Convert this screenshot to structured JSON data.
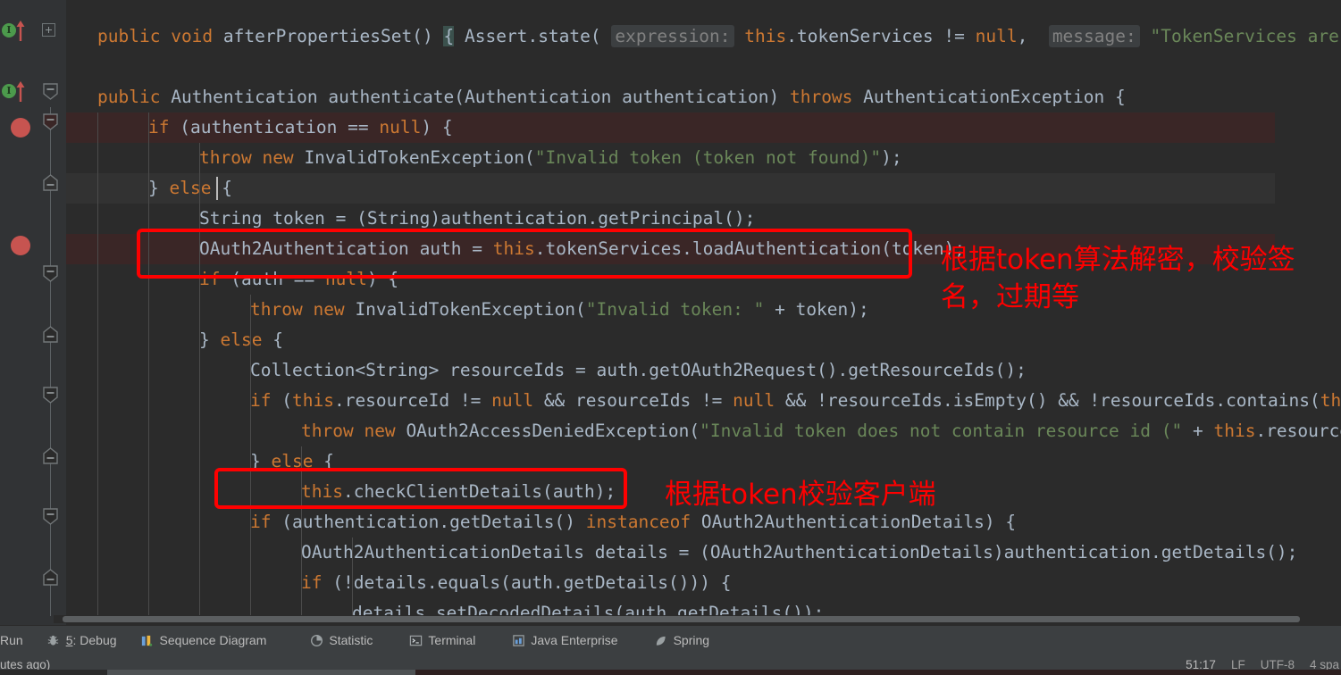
{
  "editor": {
    "language": "java",
    "font_size_px": 19.5,
    "theme": "darcula",
    "background": "#2b2b2b",
    "gutter_background": "#313335",
    "breakpoint_line_background": "#3a2626",
    "caret_line_background": "#323232",
    "lines": [
      {
        "id": "l1",
        "text": "public void afterPropertiesSet() { Assert.state( expression: this.tokenServices != null,  message: \"TokenServices are required\")",
        "indent": 1,
        "gutter": "implementation-and-override",
        "fold": "plus",
        "highlight": "none"
      },
      {
        "id": "l2",
        "text": "public Authentication authenticate(Authentication authentication) throws AuthenticationException {",
        "indent": 1,
        "gutter": "implementation-and-override",
        "fold": "fold-down",
        "highlight": "none"
      },
      {
        "id": "l3",
        "text": "if (authentication == null) {",
        "indent": 2,
        "gutter": "breakpoint",
        "fold": "fold-down",
        "highlight": "breakpoint"
      },
      {
        "id": "l4",
        "text": "throw new InvalidTokenException(\"Invalid token (token not found)\");",
        "indent": 3,
        "gutter": "none",
        "fold": "none",
        "highlight": "none"
      },
      {
        "id": "l5",
        "text": "} else {",
        "indent": 2,
        "gutter": "none",
        "fold": "fold-up",
        "highlight": "caret"
      },
      {
        "id": "l6",
        "text": "String token = (String)authentication.getPrincipal();",
        "indent": 3,
        "gutter": "none",
        "fold": "none",
        "highlight": "none"
      },
      {
        "id": "l7",
        "text": "OAuth2Authentication auth = this.tokenServices.loadAuthentication(token);",
        "indent": 3,
        "gutter": "breakpoint",
        "fold": "none",
        "highlight": "breakpoint"
      },
      {
        "id": "l8",
        "text": "if (auth == null) {",
        "indent": 3,
        "gutter": "none",
        "fold": "fold-down",
        "highlight": "none"
      },
      {
        "id": "l9",
        "text": "throw new InvalidTokenException(\"Invalid token: \" + token);",
        "indent": 4,
        "gutter": "none",
        "fold": "none",
        "highlight": "none"
      },
      {
        "id": "l10",
        "text": "} else {",
        "indent": 3,
        "gutter": "none",
        "fold": "fold-up",
        "highlight": "none"
      },
      {
        "id": "l11",
        "text": "Collection<String> resourceIds = auth.getOAuth2Request().getResourceIds();",
        "indent": 4,
        "gutter": "none",
        "fold": "none",
        "highlight": "none"
      },
      {
        "id": "l12",
        "text": "if (this.resourceId != null && resourceIds != null && !resourceIds.isEmpty() && !resourceIds.contains(this.resourc",
        "indent": 4,
        "gutter": "none",
        "fold": "fold-down",
        "highlight": "none"
      },
      {
        "id": "l13",
        "text": "throw new OAuth2AccessDeniedException(\"Invalid token does not contain resource id (\" + this.resourceId + \")\");",
        "indent": 5,
        "gutter": "none",
        "fold": "none",
        "highlight": "none"
      },
      {
        "id": "l14",
        "text": "} else {",
        "indent": 4,
        "gutter": "none",
        "fold": "fold-up",
        "highlight": "none"
      },
      {
        "id": "l15",
        "text": "this.checkClientDetails(auth);",
        "indent": 5,
        "gutter": "none",
        "fold": "none",
        "highlight": "none"
      },
      {
        "id": "l16",
        "text": "if (authentication.getDetails() instanceof OAuth2AuthenticationDetails) {",
        "indent": 5,
        "gutter": "none",
        "fold": "fold-down",
        "highlight": "none"
      },
      {
        "id": "l17",
        "text": "OAuth2AuthenticationDetails details = (OAuth2AuthenticationDetails)authentication.getDetails();",
        "indent": 6,
        "gutter": "none",
        "fold": "none",
        "highlight": "none"
      },
      {
        "id": "l18",
        "text": "if (!details.equals(auth.getDetails())) {",
        "indent": 6,
        "gutter": "none",
        "fold": "fold-down",
        "highlight": "none"
      },
      {
        "id": "l19",
        "text": "details.setDecodedDetails(auth.getDetails());",
        "indent": 7,
        "gutter": "none",
        "fold": "none",
        "highlight": "none"
      }
    ]
  },
  "annotations": {
    "color": "#ff0000",
    "box1_label": "",
    "text1": "根据token算法解密，校验签\n名，过期等",
    "box2_label": "",
    "text2": "根据token校验客户端"
  },
  "toolbar": {
    "items": [
      {
        "label": "Run",
        "icon": "run-icon",
        "shortcut": ""
      },
      {
        "label": "Debug",
        "icon": "bug-icon",
        "shortcut": "5"
      },
      {
        "label": "Sequence Diagram",
        "icon": "sequence-diagram-icon",
        "shortcut": ""
      },
      {
        "label": "Statistic",
        "icon": "pie-chart-icon",
        "shortcut": ""
      },
      {
        "label": "Terminal",
        "icon": "terminal-icon",
        "shortcut": ""
      },
      {
        "label": "Java Enterprise",
        "icon": "java-enterprise-icon",
        "shortcut": ""
      },
      {
        "label": "Spring",
        "icon": "spring-leaf-icon",
        "shortcut": ""
      }
    ]
  },
  "statusbar": {
    "left_text": "utes ago)",
    "position": "51:17",
    "line_separator": "LF",
    "encoding": "UTF-8",
    "indent": "4 spa"
  }
}
